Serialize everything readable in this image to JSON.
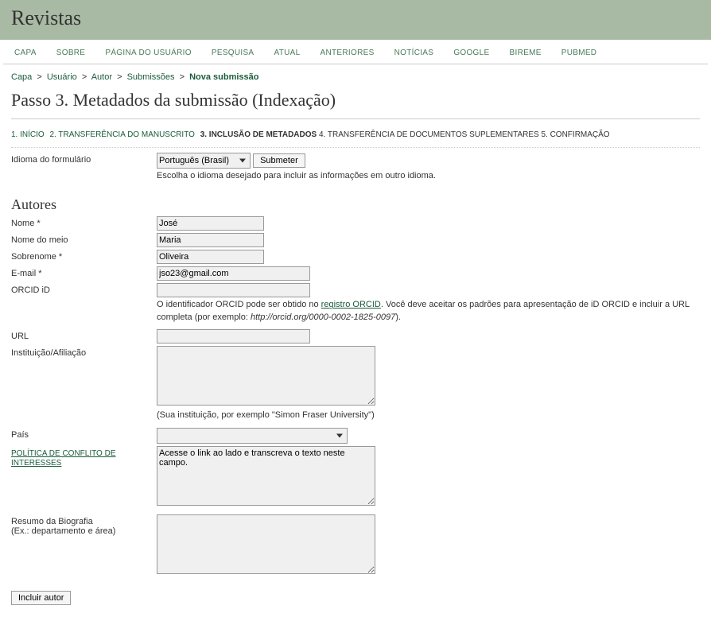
{
  "header": {
    "title": "Revistas"
  },
  "nav": {
    "items": [
      "CAPA",
      "SOBRE",
      "PÁGINA DO USUÁRIO",
      "PESQUISA",
      "ATUAL",
      "ANTERIORES",
      "NOTÍCIAS",
      "GOOGLE",
      "BIREME",
      "PUBMED"
    ]
  },
  "breadcrumb": {
    "items": [
      "Capa",
      "Usuário",
      "Autor",
      "Submissões"
    ],
    "current": "Nova submissão"
  },
  "page": {
    "title": "Passo 3. Metadados da submissão (Indexação)"
  },
  "steps": {
    "s1": "1. INÍCIO",
    "s2": "2. TRANSFERÊNCIA DO MANUSCRITO",
    "s3": "3. INCLUSÃO DE METADADOS",
    "s4": "4. TRANSFERÊNCIA DE DOCUMENTOS SUPLEMENTARES",
    "s5": "5. CONFIRMAÇÃO"
  },
  "formLanguage": {
    "label": "Idioma do formulário",
    "selected": "Português (Brasil)",
    "submit": "Submeter",
    "note": "Escolha o idioma desejado para incluir as informações em outro idioma."
  },
  "authors": {
    "heading": "Autores",
    "nome": {
      "label": "Nome *",
      "value": "José"
    },
    "meio": {
      "label": "Nome do meio",
      "value": "Maria"
    },
    "sobrenome": {
      "label": "Sobrenome *",
      "value": "Oliveira"
    },
    "email": {
      "label": "E-mail *",
      "value": "jso23@gmail.com"
    },
    "orcid": {
      "label": "ORCID iD",
      "value": "",
      "note_pre": "O identificador ORCID pode ser obtido no ",
      "note_link": "registro ORCID",
      "note_post1": ". Você deve aceitar os padrões para apresentação de iD ORCID e incluir a URL completa (por exemplo: ",
      "note_eg": "http://orcid.org/0000-0002-1825-0097",
      "note_post2": ")."
    },
    "url": {
      "label": "URL",
      "value": ""
    },
    "afiliacao": {
      "label": "Instituição/Afiliação",
      "value": "",
      "hint": "(Sua instituição, por exemplo \"Simon Fraser University\")"
    },
    "pais": {
      "label": "País",
      "selected": ""
    },
    "conflito": {
      "label": "POLÍTICA DE CONFLITO DE INTERESSES",
      "value": "Acesse o link ao lado e transcreva o texto neste campo."
    },
    "bio": {
      "label_line1": "Resumo da Biografia",
      "label_line2": "(Ex.: departamento e área)",
      "value": ""
    },
    "addBtn": "Incluir autor"
  }
}
